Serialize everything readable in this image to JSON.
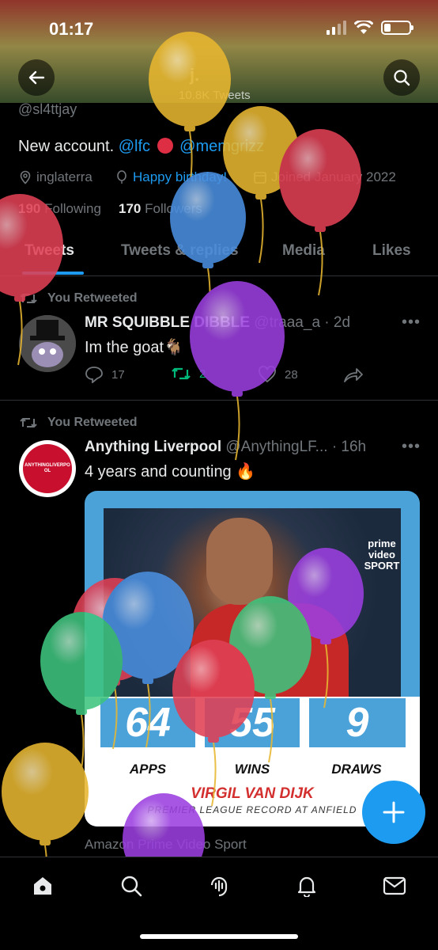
{
  "status_bar": {
    "time": "01:17"
  },
  "header": {
    "name": "j.",
    "tweet_count": "10.8K Tweets"
  },
  "profile": {
    "handle": "@sl4ttjay",
    "bio_prefix": "New account.",
    "bio_link1": "@lfc",
    "bio_link2": "@memgrizz",
    "location": "inglaterra",
    "birthday": "Happy birthday!",
    "joined": "Joined January 2022",
    "following_count": "190",
    "following_label": "Following",
    "followers_count": "170",
    "followers_label": "Followers"
  },
  "tabs": [
    {
      "label": "Tweets"
    },
    {
      "label": "Tweets & replies"
    },
    {
      "label": "Media"
    },
    {
      "label": "Likes"
    }
  ],
  "tweets": [
    {
      "retweet_label": "You Retweeted",
      "author": "MR SQUIBBLE DIBBLE",
      "handle": "@traaa_a",
      "time": "· 2d",
      "text": "Im the goat🐐",
      "replies": "17",
      "retweets": "2",
      "likes": "28"
    },
    {
      "retweet_label": "You Retweeted",
      "author": "Anything Liverpool",
      "handle": "@AnythingLF...",
      "time": "· 16h",
      "text": "4 years and counting 🔥",
      "avatar_text": "ANYTHINGLIVERPOOL",
      "media": {
        "brand": "prime video SPORT",
        "stats": [
          {
            "value": "64",
            "label": "APPS"
          },
          {
            "value": "55",
            "label": "WINS"
          },
          {
            "value": "9",
            "label": "DRAWS"
          }
        ],
        "player": "VIRGIL VAN DIJK",
        "record": "PREMIER LEAGUE RECORD AT ANFIELD"
      },
      "source": "Amazon Prime Video Sport"
    }
  ],
  "more_label": "•••",
  "icons": {
    "back": "arrow-left-icon",
    "search": "search-icon",
    "location": "location-pin-icon",
    "birthday": "balloon-icon",
    "calendar": "calendar-icon",
    "retweet": "retweet-icon",
    "reply": "reply-icon",
    "like": "heart-icon",
    "share": "share-icon",
    "compose": "plus-icon",
    "nav": [
      "home-icon",
      "search-icon",
      "spaces-icon",
      "bell-icon",
      "mail-icon"
    ]
  },
  "colors": {
    "accent": "#1d9bf0",
    "retweet_green": "#00ba7c",
    "muted": "#71767b"
  }
}
